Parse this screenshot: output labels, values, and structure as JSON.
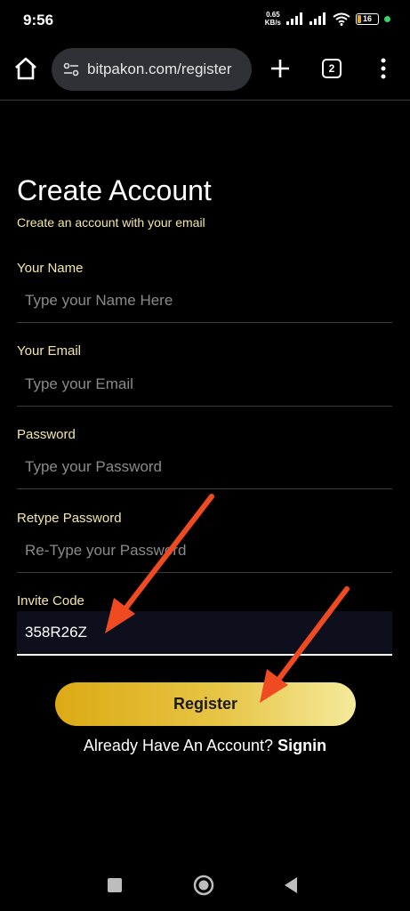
{
  "status": {
    "time": "9:56",
    "net_speed_value": "0.65",
    "net_speed_unit": "KB/s",
    "battery": "16",
    "battery_level": 0.16
  },
  "browser": {
    "url": "bitpakon.com/register",
    "tab_count": "2"
  },
  "form": {
    "title": "Create Account",
    "subtitle": "Create an account with your email",
    "name_label": "Your Name",
    "name_placeholder": "Type your Name Here",
    "email_label": "Your Email",
    "email_placeholder": "Type your Email",
    "password_label": "Password",
    "password_placeholder": "Type your Password",
    "retype_label": "Retype Password",
    "retype_placeholder": "Re-Type your Password",
    "invite_label": "Invite Code",
    "invite_value": "358R26Z",
    "register_label": "Register",
    "signin_prompt": "Already Have An Account?",
    "signin_link": "Signin"
  },
  "colors": {
    "accent": "#f3e7a5",
    "button_gradient_start": "#dcaa14",
    "button_gradient_end": "#f5ea9c",
    "annotation_arrow": "#f04a23"
  }
}
